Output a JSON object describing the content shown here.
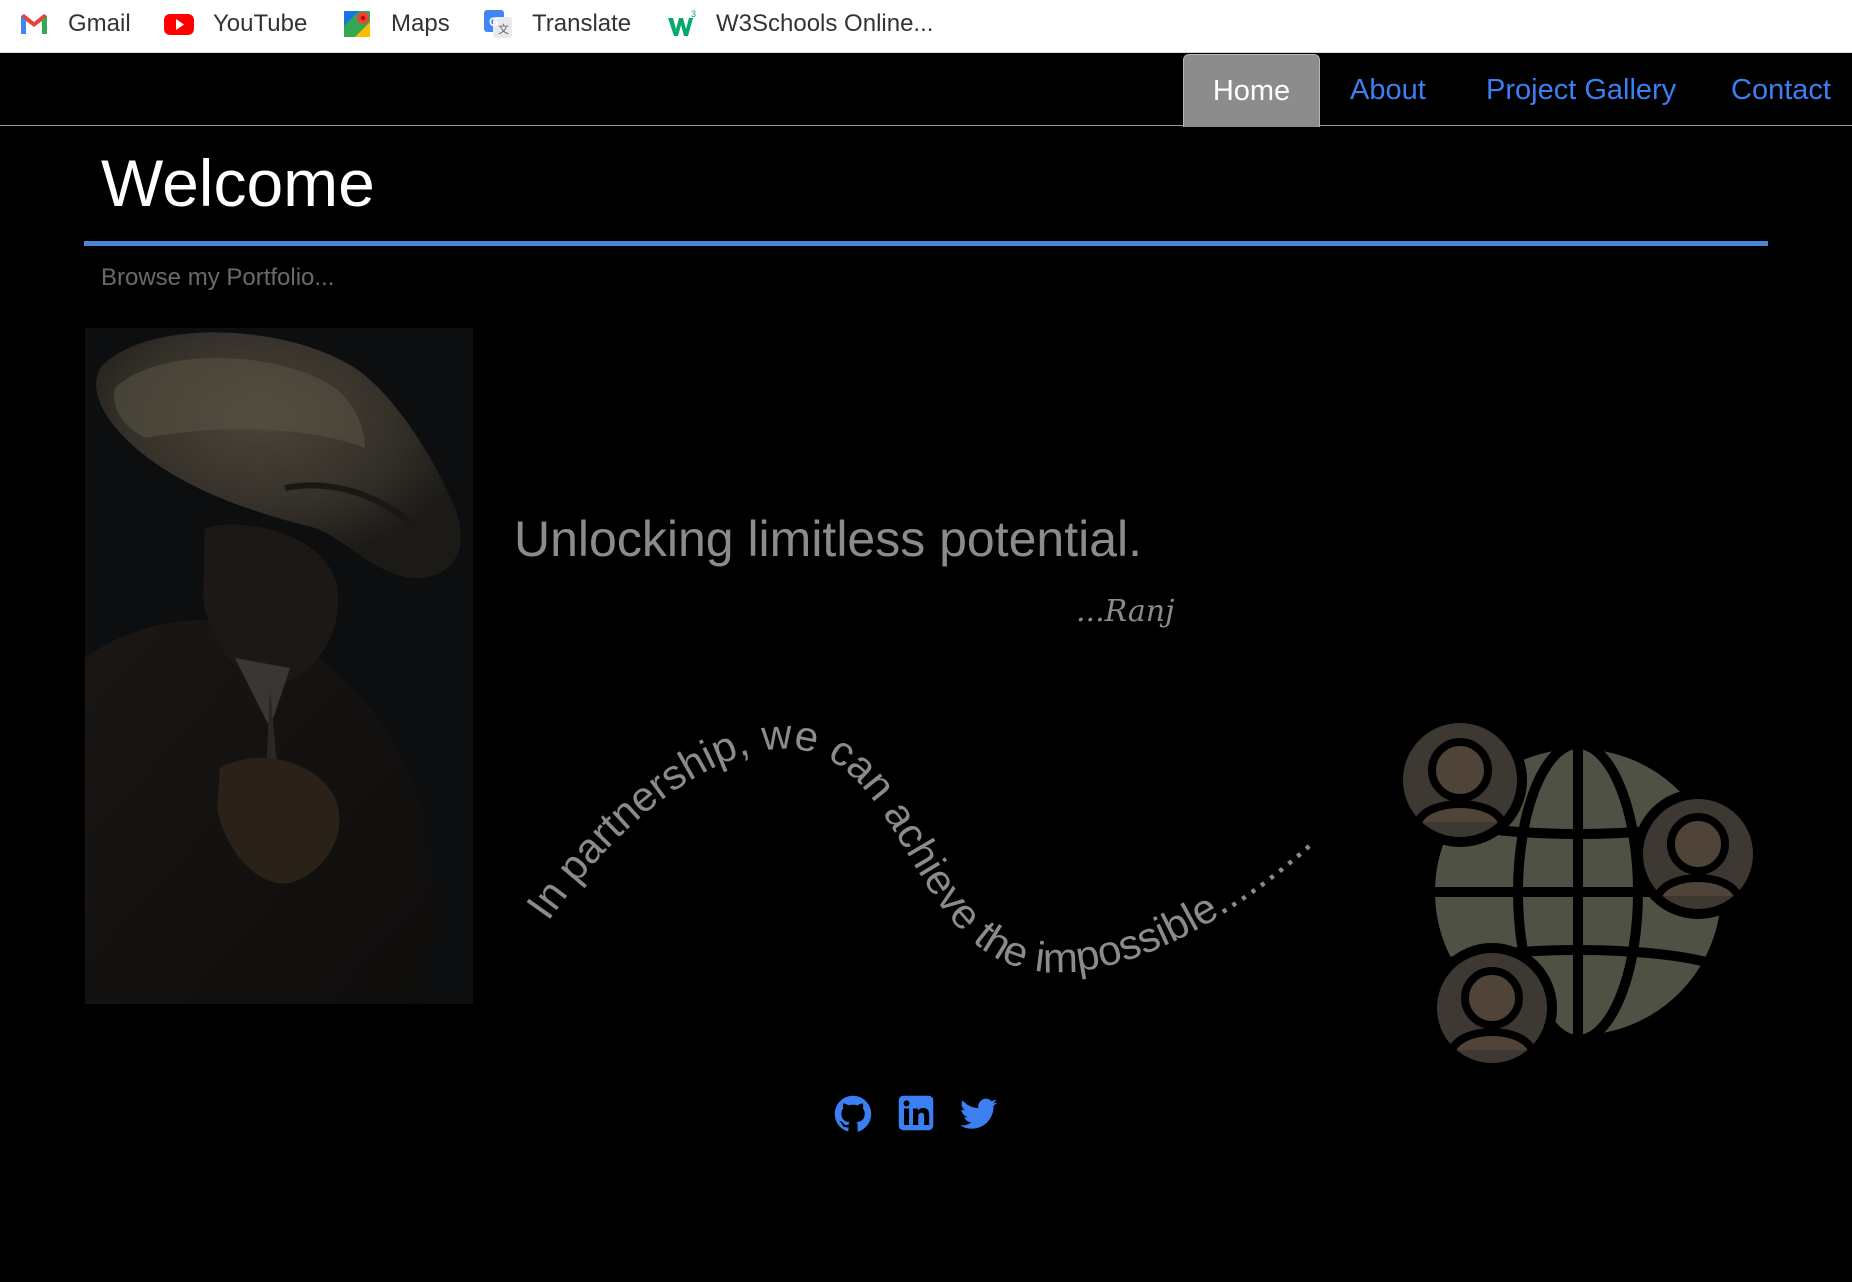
{
  "bookmarks": [
    {
      "label": "Gmail",
      "icon": "gmail-icon"
    },
    {
      "label": "YouTube",
      "icon": "youtube-icon"
    },
    {
      "label": "Maps",
      "icon": "maps-icon"
    },
    {
      "label": "Translate",
      "icon": "translate-icon"
    },
    {
      "label": "W3Schools Online...",
      "icon": "w3schools-icon"
    }
  ],
  "nav": {
    "items": [
      {
        "label": "Home",
        "active": true
      },
      {
        "label": "About",
        "active": false
      },
      {
        "label": "Project Gallery",
        "active": false
      },
      {
        "label": "Contact",
        "active": false
      }
    ]
  },
  "hero": {
    "title": "Welcome",
    "subtitle": "Browse my Portfolio...",
    "quote": "Unlocking limitless potential.",
    "signature": "...Ranj",
    "wave_text": "In partnership, we can achieve the impossible.........."
  },
  "socials": [
    {
      "icon": "github-icon"
    },
    {
      "icon": "linkedin-icon"
    },
    {
      "icon": "twitter-icon"
    }
  ],
  "colors": {
    "accent": "#3b7ff3",
    "divider": "#4a86d8",
    "active_tab": "#8c8c8c",
    "muted_text": "#8b8b8b",
    "background": "#000000"
  }
}
